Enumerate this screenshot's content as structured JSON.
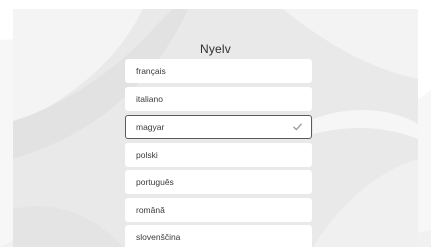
{
  "screen": {
    "title": "Nyelv"
  },
  "languages": {
    "items": [
      {
        "label": "français",
        "selected": false
      },
      {
        "label": "italiano",
        "selected": false
      },
      {
        "label": "magyar",
        "selected": true
      },
      {
        "label": "polski",
        "selected": false
      },
      {
        "label": "português",
        "selected": false
      },
      {
        "label": "română",
        "selected": false
      },
      {
        "label": "slovenščina",
        "selected": false
      }
    ],
    "selected_icon": "check-icon"
  },
  "colors": {
    "panel_background": "#ececec",
    "item_background": "#ffffff",
    "selected_border": "#5a5a5a",
    "check_color": "#9a9a9a"
  }
}
